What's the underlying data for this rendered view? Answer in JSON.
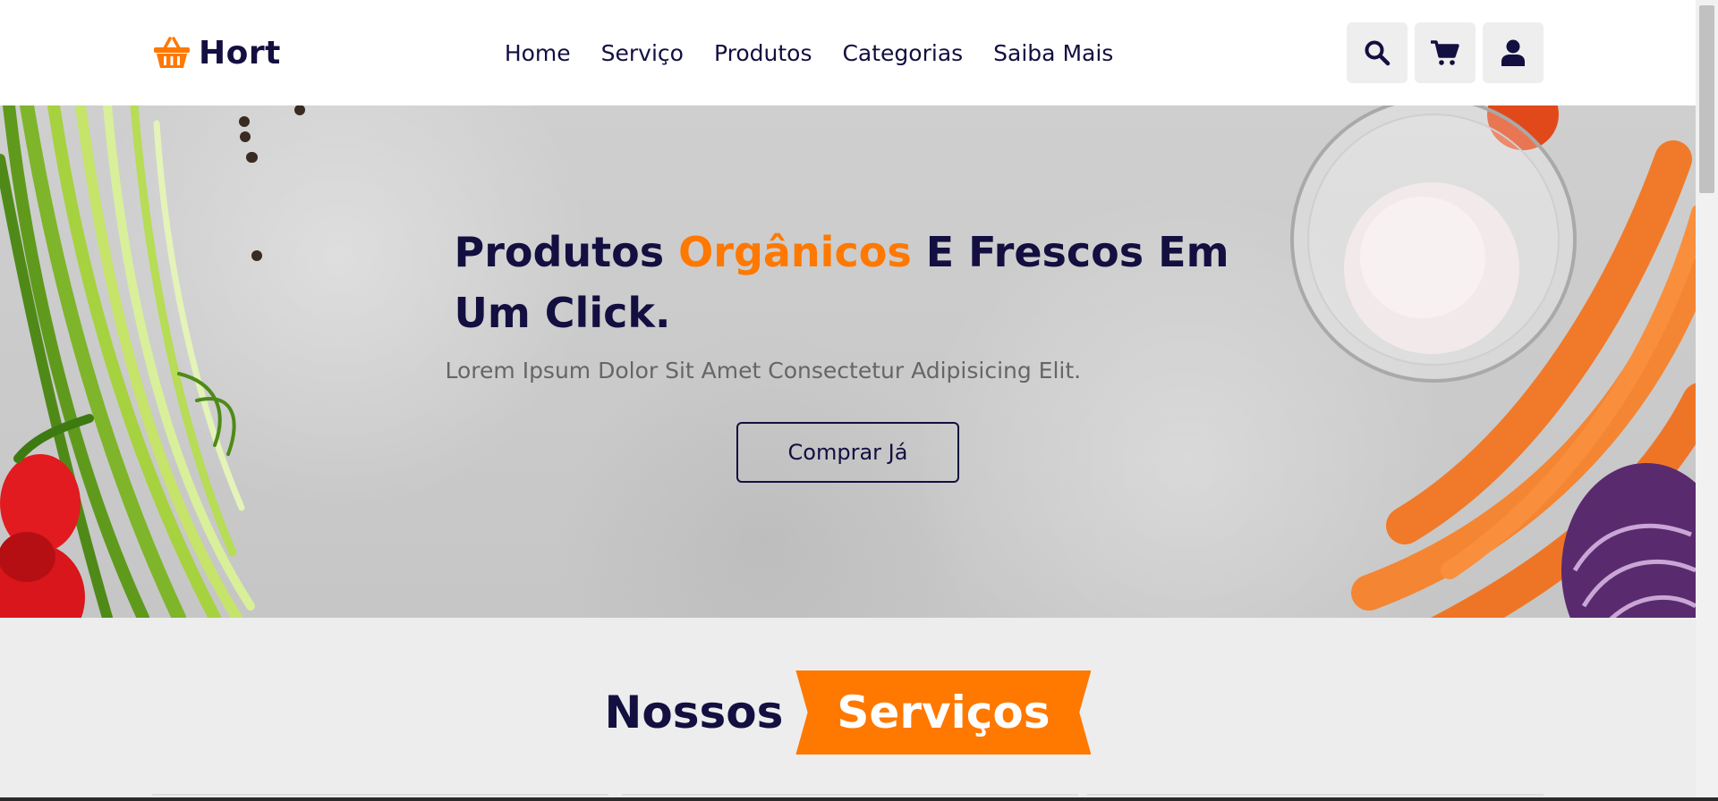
{
  "brand": {
    "name": "Hort",
    "icon": "basket-icon",
    "color": "#ff7800"
  },
  "nav": {
    "items": [
      {
        "label": "Home"
      },
      {
        "label": "Serviço"
      },
      {
        "label": "Produtos"
      },
      {
        "label": "Categorias"
      },
      {
        "label": "Saiba Mais"
      }
    ]
  },
  "header_icons": {
    "search": "search-icon",
    "cart": "cart-icon",
    "user": "user-icon"
  },
  "hero": {
    "title_part1": "Produtos ",
    "title_accent": "Orgânicos",
    "title_part2": " E Frescos Em Um Click.",
    "subtitle": "Lorem Ipsum Dolor Sit Amet Consectetur Adipisicing Elit.",
    "button_label": "Comprar Já"
  },
  "services_heading": {
    "dark": "Nossos",
    "highlight": "Serviços"
  },
  "colors": {
    "primary": "#130f40",
    "accent": "#ff7800",
    "background": "#ededed"
  }
}
